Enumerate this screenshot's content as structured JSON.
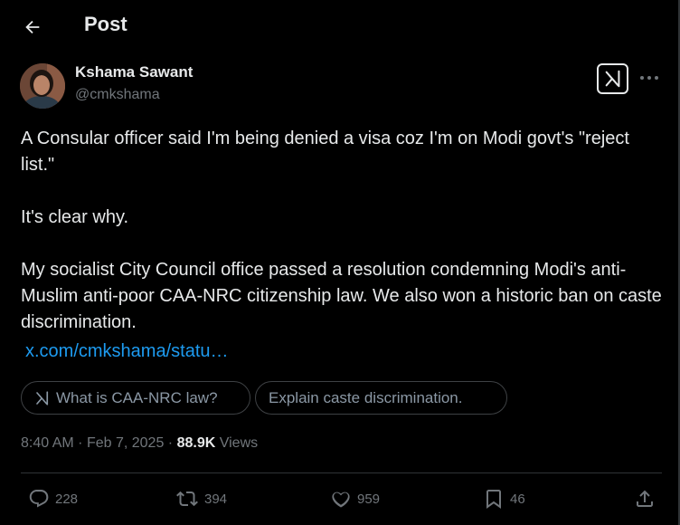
{
  "header": {
    "title": "Post",
    "back_icon": "arrow-left-icon"
  },
  "author": {
    "name": "Kshama Sawant",
    "handle": "@cmkshama"
  },
  "tweet": {
    "paragraphs": [
      "A Consular officer said I'm being denied a visa coz I'm on Modi govt's \"reject list.\"",
      "It's clear why.",
      "My socialist City Council office passed a resolution condemning Modi's anti-Muslim anti-poor CAA-NRC citizenship law. We also won a historic ban on caste discrimination."
    ],
    "link": "x.com/cmkshama/statu…"
  },
  "grok_suggestions": [
    "What is CAA-NRC law?",
    "Explain caste discrimination."
  ],
  "meta": {
    "time": "8:40 AM",
    "date": "Feb 7, 2025",
    "views_count": "88.9K",
    "views_label": "Views"
  },
  "actions": {
    "replies": "228",
    "reposts": "394",
    "likes": "959",
    "bookmarks": "46"
  },
  "colors": {
    "background": "#000000",
    "text": "#e7e9ea",
    "muted": "#71767b",
    "link": "#1d9bf0",
    "border": "#2f3336"
  }
}
